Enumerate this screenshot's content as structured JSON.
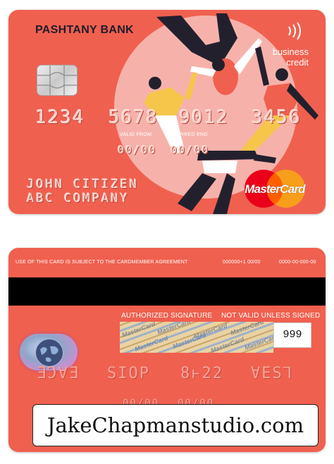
{
  "front": {
    "bank_name": "PASHTANY BANK",
    "card_type_line1": "business",
    "card_type_line2": "credit",
    "card_number_groups": [
      "1234",
      "5678",
      "9012",
      "3456"
    ],
    "valid_from_label": "VALID FROM",
    "valid_from_value": "00/00",
    "expired_end_label": "EXPIRED END",
    "expired_end_value": "00/00",
    "holder_name": "JOHN CITIZEN",
    "company": "ABC COMPANY",
    "network": "MasterCard",
    "colors": {
      "card": "#f0604f",
      "mc_red": "#eb001b",
      "mc_yellow": "#f79e1b"
    }
  },
  "back": {
    "terms_text": "USE OF THIS CARD IS SUBJECT TO THE CARDMEMBER AGREEMENT",
    "phone1": "000000+1 00/00",
    "phone2": "0000-00-000-00",
    "auth_signature_label": "AUTHORIZED SIGNATURE",
    "not_valid_label": "NOT VALID UNLESS SIGNED",
    "signature_panel_text": "MasterCard",
    "cvv": "999",
    "embossed_groups": [
      "ƎƆ∀Ǝ",
      "SIOP",
      "8ⱶ22",
      "ⱯES⅂"
    ],
    "embossed_dates": [
      "00/00",
      "00/00"
    ],
    "hologram_icon": "globe-hologram-icon"
  },
  "watermark": "JakeChapmanstudio.com"
}
